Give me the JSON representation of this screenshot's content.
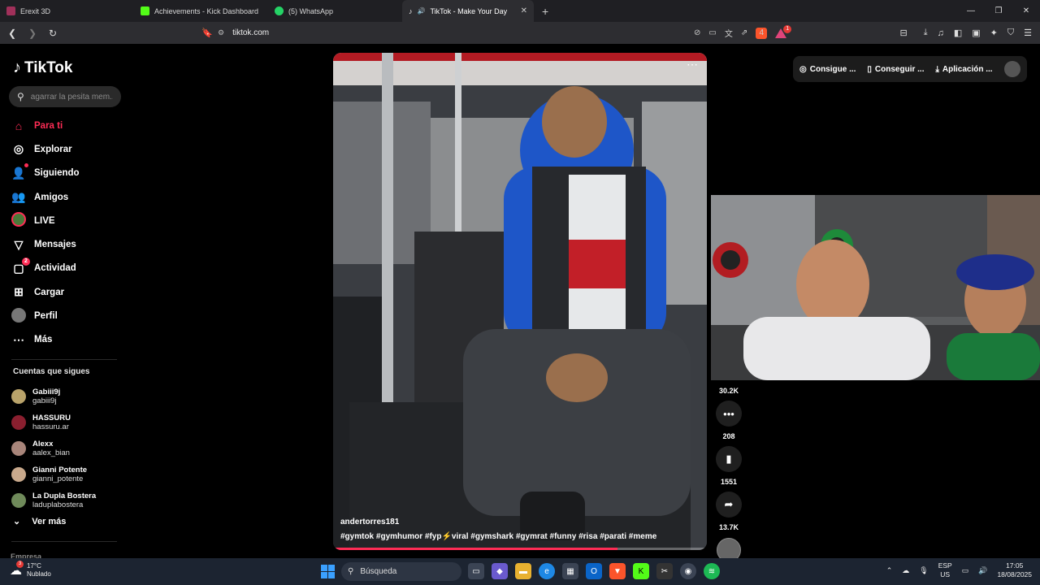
{
  "browser": {
    "tabs": [
      {
        "title": "Erexit 3D",
        "icon": "erexit-icon",
        "color": "#a0305a"
      },
      {
        "title": "Achievements - Kick Dashboard",
        "icon": "kick-icon",
        "color": "#53fc18"
      },
      {
        "title": "(5) WhatsApp",
        "icon": "whatsapp-icon",
        "color": "#25d366"
      },
      {
        "title": "TikTok - Make Your Day",
        "icon": "tiktok-icon",
        "color": "#ffffff",
        "active": true
      }
    ],
    "new_tab": "+",
    "url": "tiktok.com",
    "brave_badge": "4",
    "rewards_badge": "1"
  },
  "tiktok": {
    "logo_text": "TikTok",
    "search_placeholder": "agarrar la pesita mem...",
    "menu": [
      {
        "label": "Para ti",
        "icon": "home-icon",
        "active": true
      },
      {
        "label": "Explorar",
        "icon": "compass-icon"
      },
      {
        "label": "Siguiendo",
        "icon": "following-icon"
      },
      {
        "label": "Amigos",
        "icon": "friends-icon"
      },
      {
        "label": "LIVE",
        "icon": "live-icon"
      },
      {
        "label": "Mensajes",
        "icon": "messages-icon"
      },
      {
        "label": "Actividad",
        "icon": "activity-icon",
        "badge": "2"
      },
      {
        "label": "Cargar",
        "icon": "upload-icon"
      },
      {
        "label": "Perfil",
        "icon": "profile-icon"
      },
      {
        "label": "Más",
        "icon": "more-icon"
      }
    ],
    "following_title": "Cuentas que sigues",
    "accounts": [
      {
        "name": "Gabiii9j",
        "username": "gabiii9j",
        "color": "#b9a36a"
      },
      {
        "name": "HASSURU",
        "username": "hassuru.ar",
        "color": "#8a1f2f"
      },
      {
        "name": "Alexx",
        "username": "aalex_bian",
        "color": "#a8857a"
      },
      {
        "name": "Gianni Potente",
        "username": "gianni_potente",
        "color": "#c9a98c"
      },
      {
        "name": "La Dupla Bostera",
        "username": "laduplabostera",
        "color": "#6f8a5a"
      }
    ],
    "see_more": "Ver más",
    "footer_label": "Empresa",
    "top_actions": [
      {
        "label": "Consigue ...",
        "icon": "coin-icon"
      },
      {
        "label": "Conseguir ...",
        "icon": "phone-icon"
      },
      {
        "label": "Aplicación ...",
        "icon": "download-icon"
      }
    ],
    "video": {
      "author": "andertorres181",
      "hashtags": "#gymtok #gymhumor #fyp⚡viral #gymshark #gymrat #funny #risa #parati #meme",
      "progress": 0.76,
      "likes": "30.2K",
      "comments": "208",
      "saves": "1551",
      "shares": "13.7K"
    }
  },
  "taskbar": {
    "temperature": "17°C",
    "weather": "Nublado",
    "weather_badge": "3",
    "search_label": "Búsqueda",
    "lang_top": "ESP",
    "lang_bottom": "US",
    "time": "17:05",
    "date": "18/08/2025"
  }
}
